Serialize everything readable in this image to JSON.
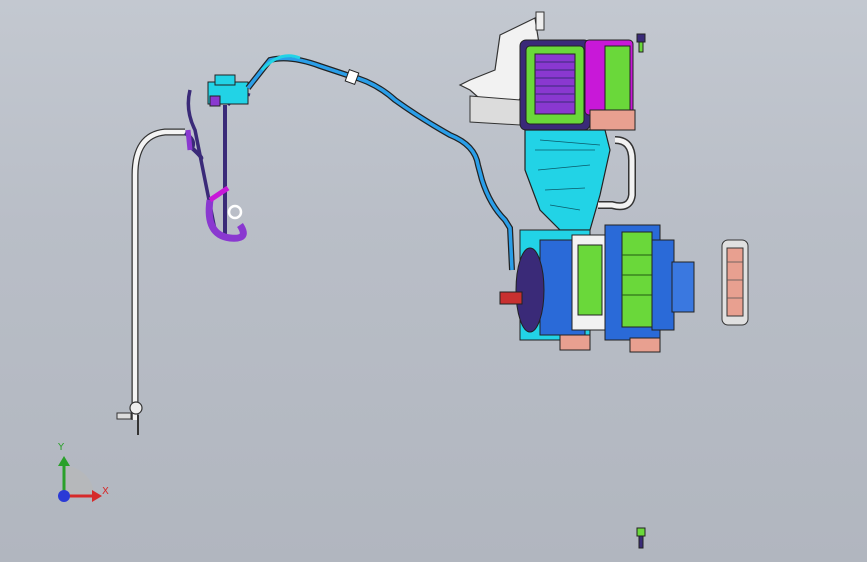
{
  "viewport": {
    "background_top": "#c3c8d0",
    "background_bottom": "#b1b6bf"
  },
  "triad": {
    "x_label": "X",
    "y_label": "Y",
    "x_color": "#d62a2a",
    "y_color": "#2aa02a",
    "z_color": "#2a3ad6"
  },
  "model": {
    "part_colors": {
      "cyan": "#22d3e6",
      "magenta": "#c818d8",
      "green": "#6ad83a",
      "blue": "#2a6ad8",
      "navy": "#3a2a78",
      "white": "#f2f2f2",
      "salmon": "#e8a090",
      "purple": "#8a38d0"
    }
  }
}
